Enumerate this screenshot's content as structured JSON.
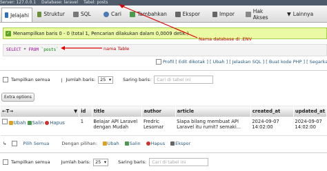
{
  "breadcrumb": {
    "server": "Server: 127.0.0.1",
    "database": "Database: laravel",
    "table": "Tabel: posts"
  },
  "tabs": [
    {
      "label": "Jelajahi",
      "color": "#2a6ec2"
    },
    {
      "label": "Struktur",
      "color": "#6c8f3a"
    },
    {
      "label": "SQL",
      "color": "#777777"
    },
    {
      "label": "Cari",
      "color": "#4d7ab3"
    },
    {
      "label": "Tambahkan",
      "color": "#4c9b4c"
    },
    {
      "label": "Ekspor",
      "color": "#666666"
    },
    {
      "label": "Impor",
      "color": "#666666"
    },
    {
      "label": "Hak Akses",
      "color": "#888888"
    },
    {
      "label": "Lainnya",
      "color": "#555555"
    }
  ],
  "message": "Menampilkan baris 0 - 0 (total 1, Pencarian dilakukan dalam 0,0009 detik.)",
  "sql": {
    "kw1": "SELECT",
    "star": " * ",
    "kw2": "FROM",
    "table": " `posts`"
  },
  "links": "Profil [ Edit dikotak ] [ Ubah ] [ Jelaskan SQL ] [ Buat kode PHP ] [ Segarka",
  "annotations": {
    "db": "Nama database di .ENV",
    "table": "nama Table"
  },
  "controls": {
    "show_all": "Tampilkan semua",
    "rows_label": "Jumlah baris:",
    "rows_value": "25",
    "filter_label": "Saring baris:",
    "filter_placeholder": "Cari di tabel ini",
    "extra": "Extra options"
  },
  "columns": [
    "id",
    "title",
    "author",
    "article",
    "created_at",
    "updated_at"
  ],
  "row": {
    "edit": "Ubah",
    "copy": "Salin",
    "delete": "Hapus",
    "id": "1",
    "title": "Belajar API Laravel dengan Mudah",
    "author": "Fredric Lesomar",
    "article": "Siapa bilang membuat API Laravel itu rumit? semaki...",
    "created_at": "2024-09-07 14:02:00",
    "updated_at": "2024-09-07 14:02:00"
  },
  "bulk": {
    "select_all": "Pilih Semua",
    "with_selected": "Dengan pilihan:",
    "edit": "Ubah",
    "copy": "Salin",
    "delete": "Hapus",
    "export": "Ekspor"
  }
}
